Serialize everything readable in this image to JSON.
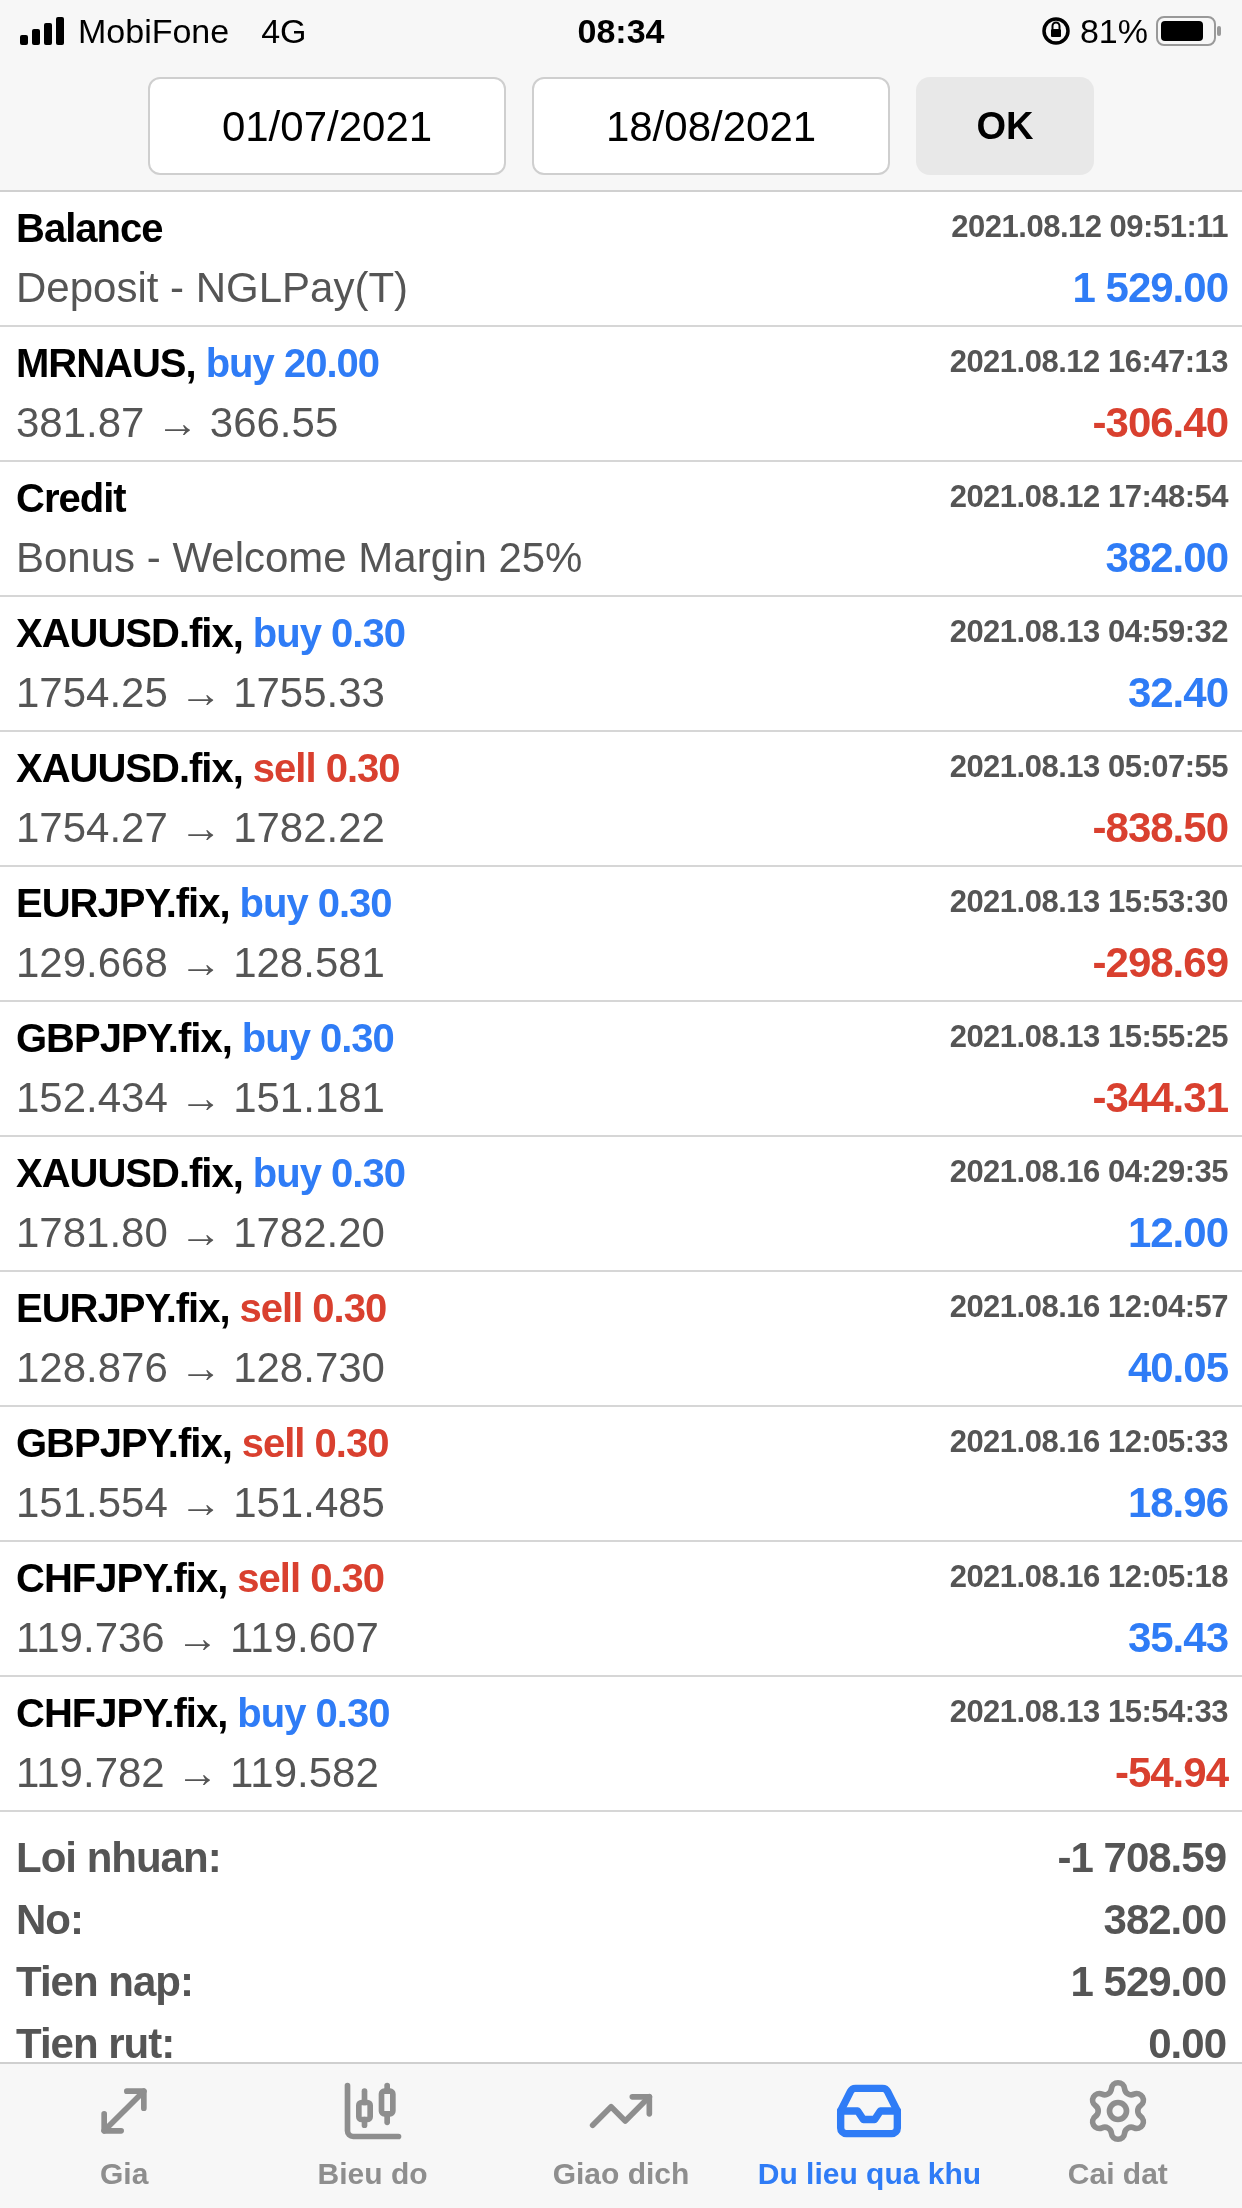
{
  "status_bar": {
    "carrier": "MobiFone",
    "network": "4G",
    "time": "08:34",
    "battery": "81%"
  },
  "date_filter": {
    "from": "01/07/2021",
    "to": "18/08/2021",
    "button": "OK"
  },
  "history": [
    {
      "kind": "balance",
      "title": "Balance",
      "time": "2021.08.12 09:51:11",
      "detail": "Deposit - NGLPay(T)",
      "amount": "1 529.00",
      "color": "#2f7cf6"
    },
    {
      "kind": "deal",
      "symbol": "MRNAUS,",
      "is_sell": false,
      "volume": "buy 20.00",
      "time": "2021.08.12 16:47:13",
      "detail": "381.87 → 366.55",
      "amount": "-306.40",
      "color": "#d9402f"
    },
    {
      "kind": "balance",
      "title": "Credit",
      "time": "2021.08.12 17:48:54",
      "detail": "Bonus - Welcome Margin 25%",
      "amount": "382.00",
      "color": "#2f7cf6"
    },
    {
      "kind": "deal",
      "symbol": "XAUUSD.fix,",
      "is_sell": false,
      "volume": "buy 0.30",
      "time": "2021.08.13 04:59:32",
      "detail": "1754.25 → 1755.33",
      "amount": "32.40",
      "color": "#2f7cf6"
    },
    {
      "kind": "deal",
      "symbol": "XAUUSD.fix,",
      "is_sell": true,
      "volume": "sell 0.30",
      "time": "2021.08.13 05:07:55",
      "detail": "1754.27 → 1782.22",
      "amount": "-838.50",
      "color": "#d9402f"
    },
    {
      "kind": "deal",
      "symbol": "EURJPY.fix,",
      "is_sell": false,
      "volume": "buy 0.30",
      "time": "2021.08.13 15:53:30",
      "detail": "129.668 → 128.581",
      "amount": "-298.69",
      "color": "#d9402f"
    },
    {
      "kind": "deal",
      "symbol": "GBPJPY.fix,",
      "is_sell": false,
      "volume": "buy 0.30",
      "time": "2021.08.13 15:55:25",
      "detail": "152.434 → 151.181",
      "amount": "-344.31",
      "color": "#d9402f"
    },
    {
      "kind": "deal",
      "symbol": "XAUUSD.fix,",
      "is_sell": false,
      "volume": "buy 0.30",
      "time": "2021.08.16 04:29:35",
      "detail": "1781.80 → 1782.20",
      "amount": "12.00",
      "color": "#2f7cf6"
    },
    {
      "kind": "deal",
      "symbol": "EURJPY.fix,",
      "is_sell": true,
      "volume": "sell 0.30",
      "time": "2021.08.16 12:04:57",
      "detail": "128.876 → 128.730",
      "amount": "40.05",
      "color": "#2f7cf6"
    },
    {
      "kind": "deal",
      "symbol": "GBPJPY.fix,",
      "is_sell": true,
      "volume": "sell 0.30",
      "time": "2021.08.16 12:05:33",
      "detail": "151.554 → 151.485",
      "amount": "18.96",
      "color": "#2f7cf6"
    },
    {
      "kind": "deal",
      "symbol": "CHFJPY.fix,",
      "is_sell": true,
      "volume": "sell 0.30",
      "time": "2021.08.16 12:05:18",
      "detail": "119.736 → 119.607",
      "amount": "35.43",
      "color": "#2f7cf6"
    },
    {
      "kind": "deal",
      "symbol": "CHFJPY.fix,",
      "is_sell": false,
      "volume": "buy 0.30",
      "time": "2021.08.13 15:54:33",
      "detail": "119.782 → 119.582",
      "amount": "-54.94",
      "color": "#d9402f"
    }
  ],
  "summary": [
    {
      "label": "Loi nhuan:",
      "value": "-1 708.59"
    },
    {
      "label": "No:",
      "value": "382.00"
    },
    {
      "label": "Tien nap:",
      "value": "1 529.00"
    },
    {
      "label": "Tien rut:",
      "value": "0.00"
    }
  ],
  "tab_bar": [
    {
      "label": "Gia",
      "selected": false
    },
    {
      "label": "Bieu do",
      "selected": false
    },
    {
      "label": "Giao dich",
      "selected": false
    },
    {
      "label": "Du lieu qua khu",
      "selected": true
    },
    {
      "label": "Cai dat",
      "selected": false
    }
  ]
}
